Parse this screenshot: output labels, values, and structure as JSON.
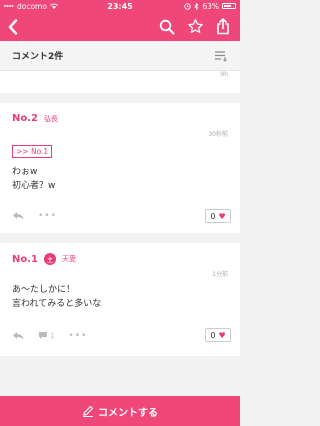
{
  "status_bar": {
    "carrier": "docomo",
    "time": "23:45",
    "battery": "63%"
  },
  "nav": {
    "back_icon": "chevron-left-icon",
    "search_icon": "search-icon",
    "favorite_icon": "star-icon",
    "share_icon": "share-icon"
  },
  "subheader": {
    "title": "コメント2件",
    "sort_icon": "sort-icon"
  },
  "top_card": {
    "time": "9h"
  },
  "comments": [
    {
      "number": "No.2",
      "name": "弘長",
      "time": "30秒前",
      "reply_ref": ">> No.1",
      "lines": [
        "わぉw",
        "初心者？w"
      ],
      "likes": "0"
    },
    {
      "number": "No.1",
      "badge": "主",
      "name": "天愛",
      "time": "1分前",
      "lines": [
        "あ〜たしかに！",
        "言われてみると多いな"
      ],
      "reply_count": "1",
      "likes": "0"
    }
  ],
  "bottom_action": {
    "label": "コメントする"
  },
  "colors": {
    "accent": "#f0477a",
    "pink_text": "#e83e73",
    "background": "#f2f2f2"
  }
}
